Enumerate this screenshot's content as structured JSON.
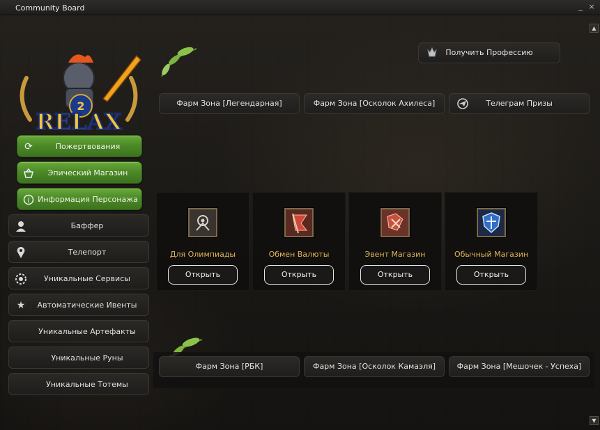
{
  "window": {
    "title": "Community Board",
    "minimize_glyph": "_",
    "close_glyph": "×"
  },
  "scroll": {
    "up_glyph": "▲",
    "down_glyph": "▼"
  },
  "logo": {
    "line1": "L2",
    "line2": "RELAX"
  },
  "green_menu": [
    {
      "label": "Пожертвования",
      "icon": "refresh-icon"
    },
    {
      "label": "Эпический Магазин",
      "icon": "basket-icon"
    },
    {
      "label": "Информация Персонажа",
      "icon": "info-icon"
    }
  ],
  "dark_menu": [
    {
      "label": "Баффер",
      "icon": "person-icon"
    },
    {
      "label": "Телепорт",
      "icon": "map-pin-icon"
    },
    {
      "label": "Уникальные Сервисы",
      "icon": "cog-icon"
    },
    {
      "label": "Автоматические Ивенты",
      "icon": "star-icon"
    },
    {
      "label": "Уникальные Артефакты"
    },
    {
      "label": "Уникальные Руны"
    },
    {
      "label": "Уникальные Тотемы"
    }
  ],
  "profession_button": {
    "label": "Получить Профессию",
    "icon": "class-emblem-icon"
  },
  "top_bar": [
    {
      "label": "Фарм Зона [Легендарная]"
    },
    {
      "label": "Фарм Зона [Осколок Ахилеса]"
    },
    {
      "label": "Телеграм Призы",
      "icon": "telegram-icon"
    }
  ],
  "shop_cards": [
    {
      "title": "Для Олимпиады",
      "button": "Открыть",
      "icon": "olympiad-icon"
    },
    {
      "title": "Обмен Валюты",
      "button": "Открыть",
      "icon": "currency-flag-icon"
    },
    {
      "title": "Эвент Магазин",
      "button": "Открыть",
      "icon": "event-shop-icon"
    },
    {
      "title": "Обычный Магазин",
      "button": "Открыть",
      "icon": "shield-shop-icon"
    }
  ],
  "bottom_bar": [
    {
      "label": "Фарм Зона [РБК]"
    },
    {
      "label": "Фарм Зона [Осколок Камаэля]"
    },
    {
      "label": "Фарм Зона [Мешочек - Успеха]"
    }
  ],
  "colors": {
    "accent_green": "#4c8a26",
    "card_title": "#e0b45a",
    "background": "#1c1a17"
  }
}
